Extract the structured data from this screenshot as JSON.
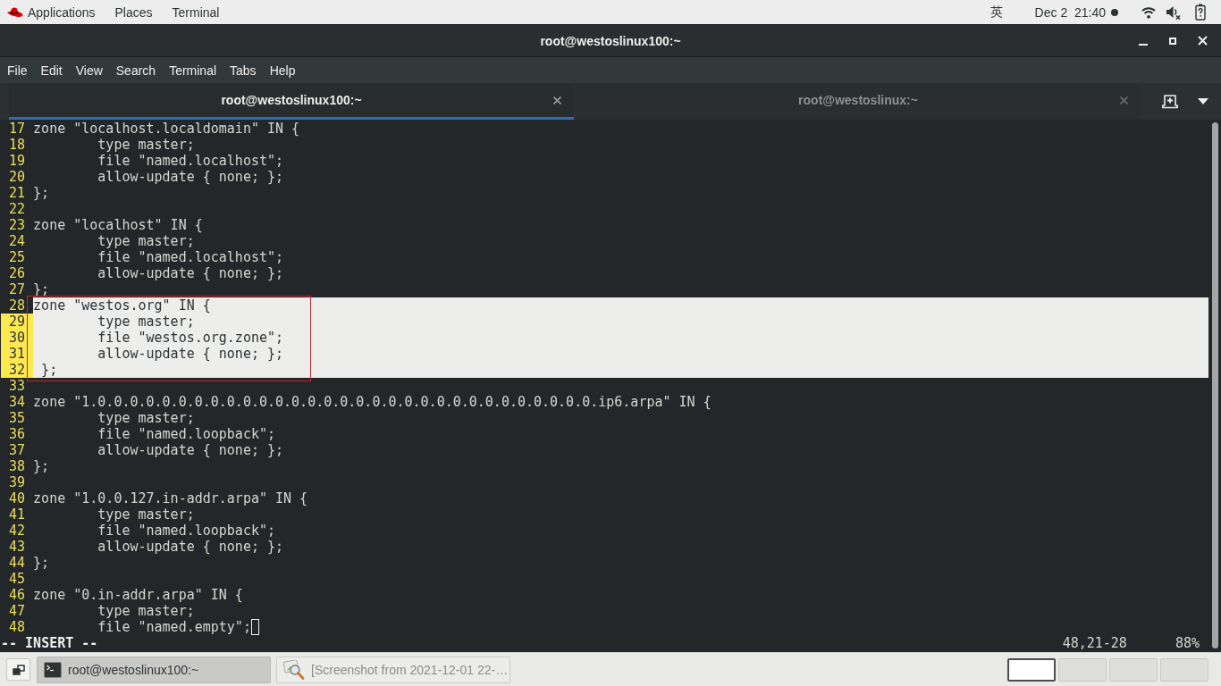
{
  "top_bar": {
    "menus": [
      "Applications",
      "Places",
      "Terminal"
    ],
    "input_method": "英",
    "clock": "Dec 2  21:40"
  },
  "window": {
    "title": "root@westoslinux100:~"
  },
  "menu_bar": [
    "File",
    "Edit",
    "View",
    "Search",
    "Terminal",
    "Tabs",
    "Help"
  ],
  "tabs": [
    {
      "label": "root@westoslinux100:~",
      "selected": true
    },
    {
      "label": "root@westoslinux:~",
      "selected": false
    }
  ],
  "editor": {
    "lines": [
      {
        "number": "17",
        "text": "zone \"localhost.localdomain\" IN {",
        "selected": false,
        "number_highlighted": false,
        "cursor": false
      },
      {
        "number": "18",
        "text": "        type master;",
        "selected": false,
        "number_highlighted": false,
        "cursor": false
      },
      {
        "number": "19",
        "text": "        file \"named.localhost\";",
        "selected": false,
        "number_highlighted": false,
        "cursor": false
      },
      {
        "number": "20",
        "text": "        allow-update { none; };",
        "selected": false,
        "number_highlighted": false,
        "cursor": false
      },
      {
        "number": "21",
        "text": "};",
        "selected": false,
        "number_highlighted": false,
        "cursor": false
      },
      {
        "number": "22",
        "selected": false,
        "number_highlighted": false,
        "cursor": false
      },
      {
        "number": "23",
        "text": "zone \"localhost\" IN {",
        "selected": false,
        "number_highlighted": false,
        "cursor": false
      },
      {
        "number": "24",
        "text": "        type master;",
        "selected": false,
        "number_highlighted": false,
        "cursor": false
      },
      {
        "number": "25",
        "text": "        file \"named.localhost\";",
        "selected": false,
        "number_highlighted": false,
        "cursor": false
      },
      {
        "number": "26",
        "text": "        allow-update { none; };",
        "selected": false,
        "number_highlighted": false,
        "cursor": false
      },
      {
        "number": "27",
        "text": "};",
        "selected": false,
        "number_highlighted": false,
        "cursor": false
      },
      {
        "number": "28",
        "text": "zone \"westos.org\" IN {",
        "selected": true,
        "number_highlighted": false,
        "cursor": false
      },
      {
        "number": "29",
        "text": "        type master;",
        "selected": true,
        "number_highlighted": true,
        "cursor": false
      },
      {
        "number": "30",
        "text": "        file \"westos.org.zone\";",
        "selected": true,
        "number_highlighted": true,
        "cursor": false
      },
      {
        "number": "31",
        "text": "        allow-update { none; };",
        "selected": true,
        "number_highlighted": true,
        "cursor": false
      },
      {
        "number": "32",
        "text": " };",
        "selected": true,
        "number_highlighted": true,
        "cursor": false
      },
      {
        "number": "33",
        "selected": false,
        "number_highlighted": false,
        "cursor": false
      },
      {
        "number": "34",
        "text": "zone \"1.0.0.0.0.0.0.0.0.0.0.0.0.0.0.0.0.0.0.0.0.0.0.0.0.0.0.0.0.0.0.0.ip6.arpa\" IN {",
        "selected": false,
        "number_highlighted": false,
        "cursor": false
      },
      {
        "number": "35",
        "text": "        type master;",
        "selected": false,
        "number_highlighted": false,
        "cursor": false
      },
      {
        "number": "36",
        "text": "        file \"named.loopback\";",
        "selected": false,
        "number_highlighted": false,
        "cursor": false
      },
      {
        "number": "37",
        "text": "        allow-update { none; };",
        "selected": false,
        "number_highlighted": false,
        "cursor": false
      },
      {
        "number": "38",
        "text": "};",
        "selected": false,
        "number_highlighted": false,
        "cursor": false
      },
      {
        "number": "39",
        "selected": false,
        "number_highlighted": false,
        "cursor": false
      },
      {
        "number": "40",
        "text": "zone \"1.0.0.127.in-addr.arpa\" IN {",
        "selected": false,
        "number_highlighted": false,
        "cursor": false
      },
      {
        "number": "41",
        "text": "        type master;",
        "selected": false,
        "number_highlighted": false,
        "cursor": false
      },
      {
        "number": "42",
        "text": "        file \"named.loopback\";",
        "selected": false,
        "number_highlighted": false,
        "cursor": false
      },
      {
        "number": "43",
        "text": "        allow-update { none; };",
        "selected": false,
        "number_highlighted": false,
        "cursor": false
      },
      {
        "number": "44",
        "text": "};",
        "selected": false,
        "number_highlighted": false,
        "cursor": false
      },
      {
        "number": "45",
        "selected": false,
        "number_highlighted": false,
        "cursor": false
      },
      {
        "number": "46",
        "text": "zone \"0.in-addr.arpa\" IN {",
        "selected": false,
        "number_highlighted": false,
        "cursor": false
      },
      {
        "number": "47",
        "text": "        type master;",
        "selected": false,
        "number_highlighted": false,
        "cursor": false
      },
      {
        "number": "48",
        "text": "        file \"named.empty\";",
        "selected": false,
        "number_highlighted": false,
        "cursor": true
      }
    ],
    "status": {
      "mode": "-- INSERT --",
      "position": "48,21-28",
      "scroll": "88%"
    }
  },
  "taskbar": {
    "windows": [
      {
        "label": "root@westoslinux100:~",
        "selected": true,
        "kind": "terminal"
      },
      {
        "label": "[Screenshot from 2021-12-01 22-…",
        "selected": false,
        "kind": "image-viewer"
      }
    ],
    "workspaces": [
      {
        "selected": true
      },
      {
        "selected": false
      },
      {
        "selected": false
      },
      {
        "selected": false
      }
    ]
  }
}
